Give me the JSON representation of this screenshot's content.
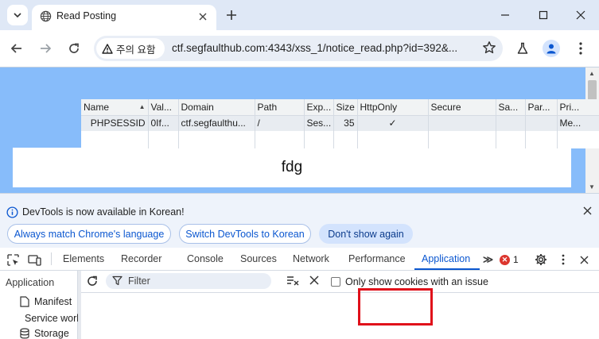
{
  "browser": {
    "tab": {
      "title": "Read Posting"
    },
    "omnibox": {
      "warning": "주의 요함",
      "url": "ctf.segfaulthub.com:4343/xss_1/notice_read.php?id=392&..."
    }
  },
  "page": {
    "post_title": "fdg"
  },
  "devtools": {
    "infobar": {
      "message": "DevTools is now available in Korean!",
      "buttons": [
        "Always match Chrome's language",
        "Switch DevTools to Korean",
        "Don't show again"
      ]
    },
    "tabs": [
      "Elements",
      "Recorder",
      "Console",
      "Sources",
      "Network",
      "Performance",
      "Application"
    ],
    "active_tab": "Application",
    "overflow": "≫",
    "error_count": "1",
    "sidebar": {
      "heading": "Application",
      "items": [
        "Manifest",
        "Service workers",
        "Storage"
      ]
    },
    "cookies": {
      "filter_placeholder": "Filter",
      "only_issue_label": "Only show cookies with an issue",
      "columns": [
        "Name",
        "Val...",
        "Domain",
        "Path",
        "Exp...",
        "Size",
        "HttpOnly",
        "Secure",
        "Sa...",
        "Par...",
        "Pri..."
      ],
      "rows": [
        [
          "PHPSESSID",
          "0If...",
          "ctf.segfaulthu...",
          "/",
          "Ses...",
          "35",
          "✓",
          "",
          "",
          "",
          "Me..."
        ]
      ]
    }
  },
  "colors": {
    "page_background": "#87bcfa",
    "highlight_box": "#e0101a",
    "accent": "#0b57d0"
  }
}
